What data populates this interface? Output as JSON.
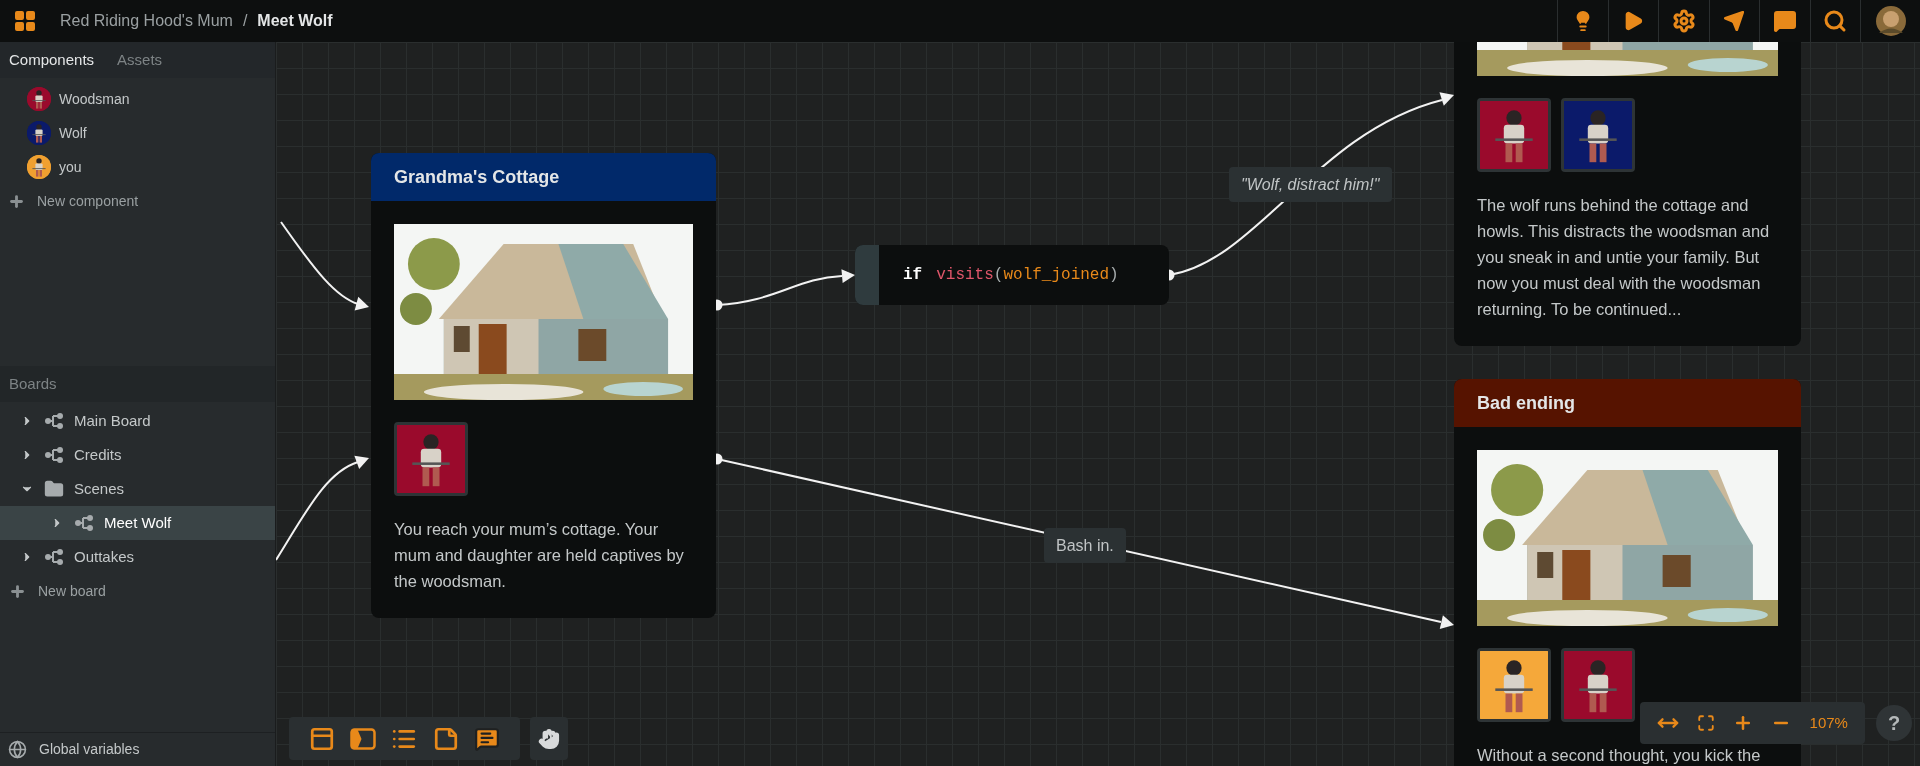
{
  "topbar": {
    "project": "Red Riding Hood's Mum",
    "separator": "/",
    "board": "Meet Wolf"
  },
  "sidebar": {
    "tabs": [
      {
        "label": "Components",
        "selected": true
      },
      {
        "label": "Assets",
        "selected": false
      }
    ],
    "components": [
      {
        "name": "Woodsman",
        "color": "#9a0a2c"
      },
      {
        "name": "Wolf",
        "color": "#0b1a6a"
      },
      {
        "name": "you",
        "color": "#f0a030"
      }
    ],
    "new_component": "New component",
    "boards_title": "Boards",
    "boards": [
      {
        "label": "Main Board",
        "kind": "board",
        "expanded": false,
        "selected": false
      },
      {
        "label": "Credits",
        "kind": "board",
        "expanded": false,
        "selected": false
      },
      {
        "label": "Scenes",
        "kind": "folder",
        "expanded": true,
        "selected": false,
        "children": [
          {
            "label": "Meet Wolf",
            "kind": "board",
            "expanded": false,
            "selected": true
          }
        ]
      },
      {
        "label": "Outtakes",
        "kind": "board",
        "expanded": false,
        "selected": false
      }
    ],
    "new_board": "New board",
    "global_variables": "Global variables"
  },
  "canvas": {
    "nodes": [
      {
        "kind": "scene",
        "title": "Grandma's Cottage",
        "color": "#01296a",
        "picture": {
          "kind": "picture"
        },
        "characters": [
          {
            "color": "#9a0a2c"
          }
        ],
        "text": "You reach your mum’s cottage. Your mum and daughter are held captives by the woodsman."
      },
      {
        "kind": "condition",
        "keyword": "if",
        "function": "visits",
        "open": "(",
        "argument": "wolf_joined",
        "close": ")"
      },
      {
        "kind": "scene",
        "picture": {
          "kind": "picture"
        },
        "characters": [
          {
            "color": "#9a0a2c"
          },
          {
            "color": "#0b1a6a"
          }
        ],
        "text": "The wolf runs behind the cottage and howls. This distracts the woodsman and you sneak in and untie your family. But now you must deal with the woodsman returning. To be continued..."
      },
      {
        "kind": "scene",
        "title": "Bad ending",
        "color": "#561300",
        "picture": {
          "kind": "picture"
        },
        "characters": [
          {
            "color": "#f5a83a"
          },
          {
            "color": "#9a0a2c"
          }
        ],
        "text": "Without a second thought, you kick the"
      }
    ],
    "edge_labels": [
      {
        "text": "\"Wolf, distract him!\"",
        "italic": true
      },
      {
        "text": "Bash in.",
        "italic": false
      }
    ],
    "zoom": "107%",
    "help": "?"
  }
}
